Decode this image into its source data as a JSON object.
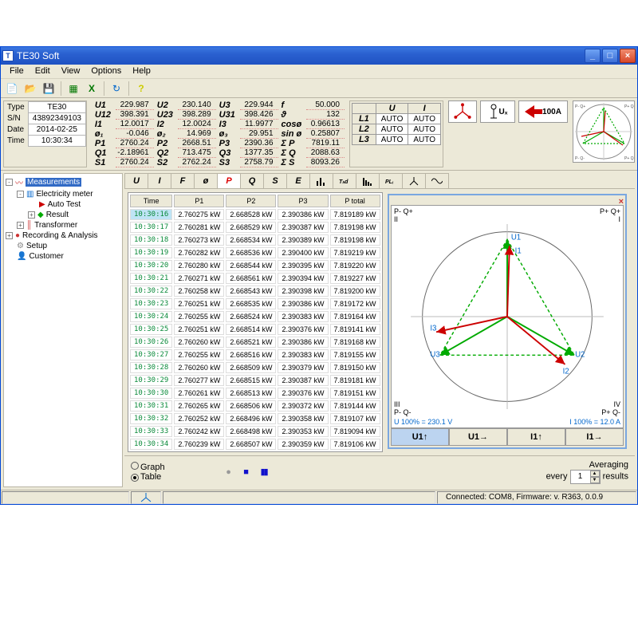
{
  "window": {
    "title": "TE30  Soft"
  },
  "menu": [
    "File",
    "Edit",
    "View",
    "Options",
    "Help"
  ],
  "info": {
    "type_lbl": "Type",
    "type": "TE30",
    "sn_lbl": "S/N",
    "sn": "43892349103",
    "date_lbl": "Date",
    "date": "2014-02-25",
    "time_lbl": "Time",
    "time": "10:30:34"
  },
  "meas": {
    "r1": [
      {
        "l": "U1",
        "v": "229.987"
      },
      {
        "l": "U2",
        "v": "230.140"
      },
      {
        "l": "U3",
        "v": "229.944"
      },
      {
        "l": "f",
        "v": "50.000"
      }
    ],
    "r2": [
      {
        "l": "U12",
        "v": "398.391"
      },
      {
        "l": "U23",
        "v": "398.289"
      },
      {
        "l": "U31",
        "v": "398.426"
      },
      {
        "l": "ϑ",
        "v": "132"
      }
    ],
    "r3": [
      {
        "l": "I1",
        "v": "12.0017"
      },
      {
        "l": "I2",
        "v": "12.0024"
      },
      {
        "l": "I3",
        "v": "11.9977"
      },
      {
        "l": "cosø",
        "v": "0.96613"
      }
    ],
    "r4": [
      {
        "l": "ø₁",
        "v": "-0.046"
      },
      {
        "l": "ø₂",
        "v": "14.969"
      },
      {
        "l": "ø₃",
        "v": "29.951"
      },
      {
        "l": "sin ø",
        "v": "0.25807"
      }
    ],
    "r5": [
      {
        "l": "P1",
        "v": "2760.24"
      },
      {
        "l": "P2",
        "v": "2668.51"
      },
      {
        "l": "P3",
        "v": "2390.36"
      },
      {
        "l": "Σ P",
        "v": "7819.11"
      }
    ],
    "r6": [
      {
        "l": "Q1",
        "v": "-2.18961"
      },
      {
        "l": "Q2",
        "v": "713.475"
      },
      {
        "l": "Q3",
        "v": "1377.35"
      },
      {
        "l": "Σ Q",
        "v": "2088.63"
      }
    ],
    "r7": [
      {
        "l": "S1",
        "v": "2760.24"
      },
      {
        "l": "S2",
        "v": "2762.24"
      },
      {
        "l": "S3",
        "v": "2758.79"
      },
      {
        "l": "Σ S",
        "v": "8093.26"
      }
    ]
  },
  "auto": {
    "head": [
      "",
      "U",
      "I"
    ],
    "rows": [
      [
        "L1",
        "AUTO",
        "AUTO"
      ],
      [
        "L2",
        "AUTO",
        "AUTO"
      ],
      [
        "L3",
        "AUTO",
        "AUTO"
      ]
    ]
  },
  "conn": {
    "ux": "Uₓ",
    "clamp": "100A"
  },
  "tree": [
    {
      "txt": "Measurements",
      "sel": true,
      "icon": "wave",
      "pm": "-"
    },
    {
      "txt": "Electricity meter",
      "ind": 1,
      "icon": "meter",
      "pm": "-"
    },
    {
      "txt": "Auto Test",
      "ind": 2,
      "icon": "play"
    },
    {
      "txt": "Result",
      "ind": 2,
      "icon": "result",
      "pm": "+"
    },
    {
      "txt": "Transformer",
      "ind": 1,
      "icon": "xfmr",
      "pm": "+"
    },
    {
      "txt": "Recording & Analysis",
      "icon": "rec",
      "pm": "+"
    },
    {
      "txt": "Setup",
      "icon": "gear"
    },
    {
      "txt": "Customer",
      "icon": "cust"
    }
  ],
  "tabs": [
    "U",
    "I",
    "F",
    "ø",
    "P",
    "Q",
    "S",
    "E"
  ],
  "active_tab": "P",
  "table": {
    "head": [
      "Time",
      "P1",
      "P2",
      "P3",
      "P total"
    ],
    "rows": [
      [
        "10:30:16",
        "2.760275 kW",
        "2.668528 kW",
        "2.390386 kW",
        "7.819189 kW"
      ],
      [
        "10:30:17",
        "2.760281 kW",
        "2.668529 kW",
        "2.390387 kW",
        "7.819198 kW"
      ],
      [
        "10:30:18",
        "2.760273 kW",
        "2.668534 kW",
        "2.390389 kW",
        "7.819198 kW"
      ],
      [
        "10:30:19",
        "2.760282 kW",
        "2.668536 kW",
        "2.390400 kW",
        "7.819219 kW"
      ],
      [
        "10:30:20",
        "2.760280 kW",
        "2.668544 kW",
        "2.390395 kW",
        "7.819220 kW"
      ],
      [
        "10:30:21",
        "2.760271 kW",
        "2.668561 kW",
        "2.390394 kW",
        "7.819227 kW"
      ],
      [
        "10:30:22",
        "2.760258 kW",
        "2.668543 kW",
        "2.390398 kW",
        "7.819200 kW"
      ],
      [
        "10:30:23",
        "2.760251 kW",
        "2.668535 kW",
        "2.390386 kW",
        "7.819172 kW"
      ],
      [
        "10:30:24",
        "2.760255 kW",
        "2.668524 kW",
        "2.390383 kW",
        "7.819164 kW"
      ],
      [
        "10:30:25",
        "2.760251 kW",
        "2.668514 kW",
        "2.390376 kW",
        "7.819141 kW"
      ],
      [
        "10:30:26",
        "2.760260 kW",
        "2.668521 kW",
        "2.390386 kW",
        "7.819168 kW"
      ],
      [
        "10:30:27",
        "2.760255 kW",
        "2.668516 kW",
        "2.390383 kW",
        "7.819155 kW"
      ],
      [
        "10:30:28",
        "2.760260 kW",
        "2.668509 kW",
        "2.390379 kW",
        "7.819150 kW"
      ],
      [
        "10:30:29",
        "2.760277 kW",
        "2.668515 kW",
        "2.390387 kW",
        "7.819181 kW"
      ],
      [
        "10:30:30",
        "2.760261 kW",
        "2.668513 kW",
        "2.390376 kW",
        "7.819151 kW"
      ],
      [
        "10:30:31",
        "2.760265 kW",
        "2.668506 kW",
        "2.390372 kW",
        "7.819144 kW"
      ],
      [
        "10:30:32",
        "2.760252 kW",
        "2.668496 kW",
        "2.390358 kW",
        "7.819107 kW"
      ],
      [
        "10:30:33",
        "2.760242 kW",
        "2.668498 kW",
        "2.390353 kW",
        "7.819094 kW"
      ],
      [
        "10:30:34",
        "2.760239 kW",
        "2.668507 kW",
        "2.390359 kW",
        "7.819106 kW"
      ]
    ],
    "sel_first": true
  },
  "vector": {
    "q1": "P+ Q+\nI",
    "q2": "P- Q+\nII",
    "q3": "III\nP- Q-",
    "q4": "IV\nP+ Q-",
    "u100": "U 100% = 230.1 V",
    "i100": "I 100% = 12.0 A",
    "btns": [
      "U1↑",
      "U1→",
      "I1↑",
      "I1→"
    ],
    "active_btn": 0,
    "labels": {
      "u1": "U1",
      "u2": "U2",
      "u3": "U3",
      "i1": "I1",
      "i2": "I2",
      "i3": "I3"
    }
  },
  "bot": {
    "graph": "Graph",
    "table": "Table",
    "avg": "Averaging",
    "every": "every",
    "results": "results",
    "avg_n": "1"
  },
  "status": {
    "conn": "Connected: COM8,   Firmware: v. R363, 0.0.9"
  }
}
